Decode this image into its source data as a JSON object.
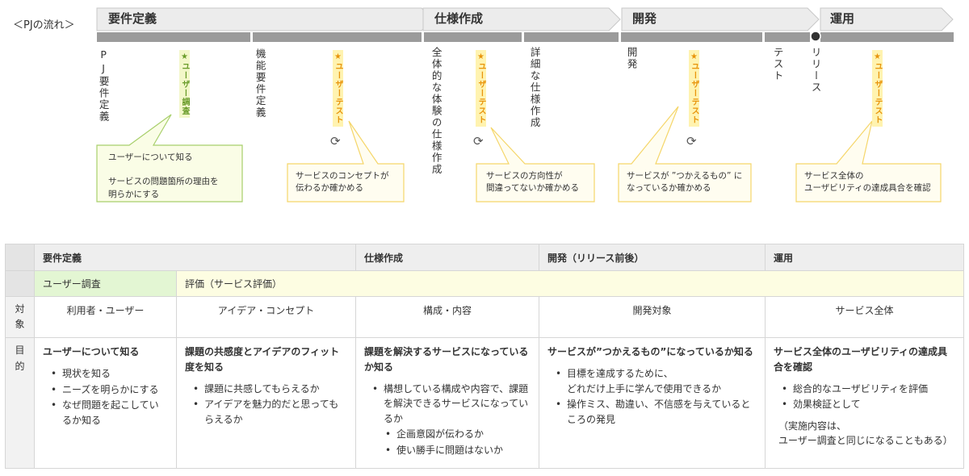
{
  "flow_title": "＜PJの流れ＞",
  "phases": [
    {
      "label": "要件定義"
    },
    {
      "label": "仕様作成"
    },
    {
      "label": "開発"
    },
    {
      "label": "運用"
    }
  ],
  "steps": {
    "pj_req": "PJ要件定義",
    "func_req": "機能要件定義",
    "overall_spec": "全体的な体験の仕様作成",
    "detail_spec": "詳細な仕様作成",
    "dev": "開発",
    "test": "テスト",
    "release": "リリース"
  },
  "markers": {
    "user_research": "★ユーザー調査",
    "user_test_1": "★ユーザーテスト",
    "user_test_2": "★ユーザーテスト",
    "user_test_3": "★ユーザーテスト",
    "user_test_4": "★ユーザーテスト"
  },
  "cycle_icon": "cycle-icon",
  "callouts": {
    "c1": "ユーザーについて知る\n\nサービスの問題箇所の理由を\n明らかにする",
    "c2": "サービスのコンセプトが\n伝わるか確かめる",
    "c3": "サービスの方向性が\n間違ってないか確かめる",
    "c4": "サービスが ”つかえるもの” に\nなっているか確かめる",
    "c5": "サービス全体の\nユーザビリティの達成具合を確認"
  },
  "colors": {
    "phase_fill": "#ececec",
    "bar": "#9b9b9b",
    "green_callout": "#fafde6",
    "green_border": "#a8cf6b",
    "yellow_callout": "#fffdf0",
    "yellow_border": "#f5d66a"
  },
  "table": {
    "headers": [
      "要件定義",
      "仕様作成",
      "開発（リリース前後）",
      "運用"
    ],
    "level_row": {
      "green": "ユーザー調査",
      "yellow": "評価（サービス評価）"
    },
    "target_label": [
      "対",
      "象"
    ],
    "targets": [
      "利用者・ユーザー",
      "アイデア・コンセプト",
      "構成・内容",
      "開発対象",
      "サービス全体"
    ],
    "purpose_label": [
      "目",
      "的"
    ],
    "purposes": [
      {
        "title": "ユーザーについて知る",
        "bullets": [
          "現状を知る",
          "ニーズを明らかにする",
          "なぜ問題を起こしているか知る"
        ]
      },
      {
        "title": "課題の共感度とアイデアのフィット度を知る",
        "bullets": [
          "課題に共感してもらえるか",
          "アイデアを魅力的だと思ってもらえるか"
        ]
      },
      {
        "title": "課題を解決するサービスになっているか知る",
        "bullets": [
          "構想している構成や内容で、課題を解決できるサービスになっているか"
        ],
        "sub": [
          "企画意図が伝わるか",
          "使い勝手に問題はないか"
        ]
      },
      {
        "title": "サービスが”つかえるもの”になっているか知る",
        "bullets": [
          "目標を達成するために、\nどれだけ上手に学んで使用できるか",
          "操作ミス、勘違い、不信感を与えているところの発見"
        ]
      },
      {
        "title": "サービス全体のユーザビリティの達成具合を確認",
        "bullets": [
          "総合的なユーザビリティを評価",
          "効果検証として"
        ],
        "note": "（実施内容は、\nユーザー調査と同じになることもある）"
      }
    ]
  }
}
